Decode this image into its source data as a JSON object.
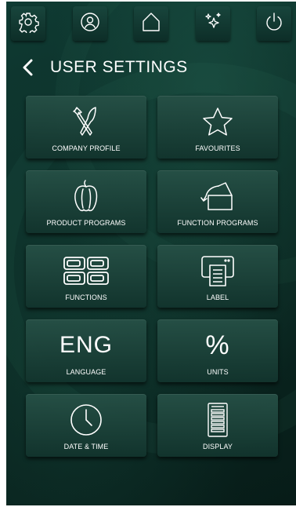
{
  "topbar": {
    "buttons": [
      {
        "icon": "settings-gear-icon"
      },
      {
        "icon": "user-profile-icon"
      },
      {
        "icon": "home-icon"
      },
      {
        "icon": "sparkles-icon"
      },
      {
        "icon": "power-icon"
      }
    ]
  },
  "header": {
    "title": "USER SETTINGS",
    "back_icon": "chevron-left-icon"
  },
  "tiles": [
    {
      "label": "COMPANY PROFILE",
      "icon": "fork-knife-icon"
    },
    {
      "label": "FAVOURITES",
      "icon": "star-icon"
    },
    {
      "label": "PRODUCT PROGRAMS",
      "icon": "pepper-icon"
    },
    {
      "label": "FUNCTION PROGRAMS",
      "icon": "box-open-icon"
    },
    {
      "label": "FUNCTIONS",
      "icon": "grid-toggles-icon"
    },
    {
      "label": "LABEL",
      "icon": "label-printer-icon"
    },
    {
      "label": "LANGUAGE",
      "icon_text": "ENG"
    },
    {
      "label": "UNITS",
      "icon_text": "%"
    },
    {
      "label": "DATE & TIME",
      "icon": "clock-icon"
    },
    {
      "label": "DISPLAY",
      "icon": "display-icon"
    }
  ],
  "colors": {
    "background": "#0b2a24",
    "tile": "#1f4a40",
    "icon": "#ffffff"
  }
}
